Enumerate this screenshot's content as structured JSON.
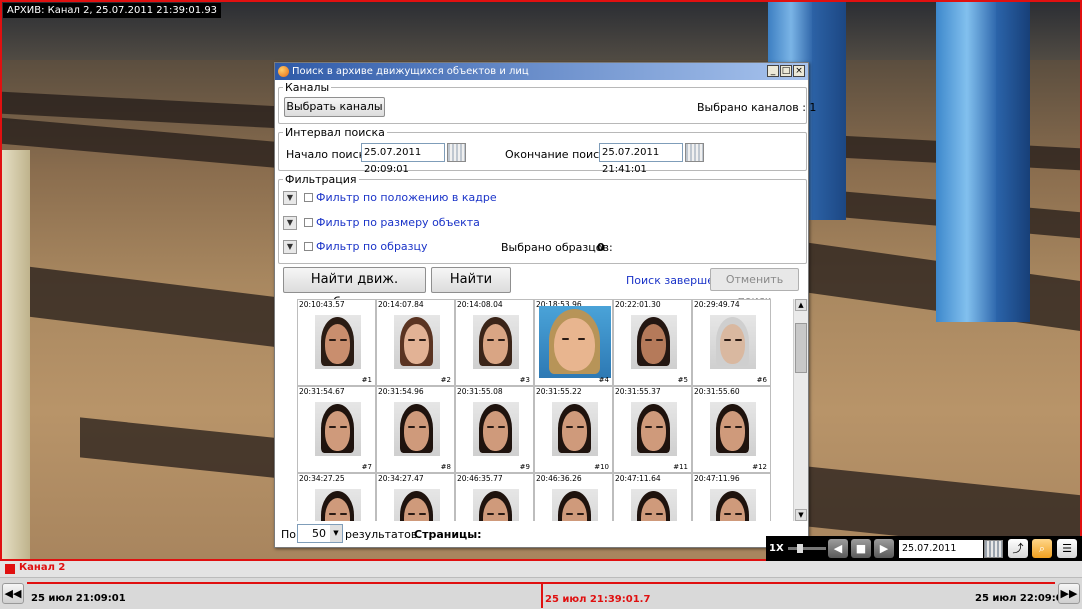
{
  "video": {
    "archive_label": "АРХИВ: Канал 2, 25.07.2011 21:39:01.93"
  },
  "dialog": {
    "title": "Поиск в архиве движущихся объектов и лиц",
    "channels": {
      "legend": "Каналы",
      "select_button": "Выбрать каналы",
      "selected_text": "Выбрано каналов : 1"
    },
    "interval": {
      "legend": "Интервал поиска",
      "start_label": "Начало поиска",
      "start_value": "25.07.2011 20:09:01",
      "end_label": "Окончание поиска",
      "end_value": "25.07.2011 21:41:01"
    },
    "filter": {
      "legend": "Фильтрация",
      "position": "Фильтр по положению в кадре",
      "size": "Фильтр по размеру объекта",
      "sample": "Фильтр по образцу",
      "samples_label": "Выбрано образцов:",
      "samples_count": "0"
    },
    "actions": {
      "find_objects": "Найти движ. объекты",
      "find_faces": "Найти лица",
      "status": "Поиск завершен.",
      "cancel": "Отменить поиск"
    },
    "results": [
      {
        "time": "20:10:43.57",
        "num": "#1"
      },
      {
        "time": "20:14:07.84",
        "num": "#2"
      },
      {
        "time": "20:14:08.04",
        "num": "#3"
      },
      {
        "time": "20:18:53.96",
        "num": "#4"
      },
      {
        "time": "20:22:01.30",
        "num": "#5"
      },
      {
        "time": "20:29:49.74",
        "num": "#6"
      },
      {
        "time": "20:31:54.67",
        "num": "#7"
      },
      {
        "time": "20:31:54.96",
        "num": "#8"
      },
      {
        "time": "20:31:55.08",
        "num": "#9"
      },
      {
        "time": "20:31:55.22",
        "num": "#10"
      },
      {
        "time": "20:31:55.37",
        "num": "#11"
      },
      {
        "time": "20:31:55.60",
        "num": "#12"
      },
      {
        "time": "20:34:27.25",
        "num": ""
      },
      {
        "time": "20:34:27.47",
        "num": ""
      },
      {
        "time": "20:46:35.77",
        "num": ""
      },
      {
        "time": "20:46:36.26",
        "num": ""
      },
      {
        "time": "20:47:11.64",
        "num": ""
      },
      {
        "time": "20:47:11.96",
        "num": ""
      }
    ],
    "pager": {
      "per_label": "По",
      "per_value": "50",
      "results_label": "результатов",
      "pages_label": "Страницы:"
    }
  },
  "controls": {
    "speed": "1X",
    "datetime": "25.07.2011 21:39:01"
  },
  "timeline": {
    "channel": "Канал 2",
    "start": "25 июл 21:09:01",
    "current": "25 июл 21:39:01.7",
    "end": "25 июл 22:09:01",
    "accent": "#e01010"
  }
}
